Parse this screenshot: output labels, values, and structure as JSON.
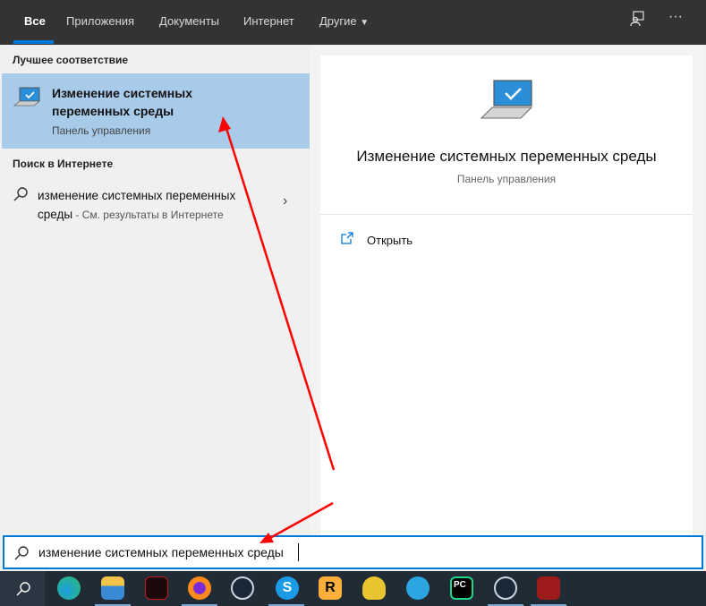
{
  "tabs": [
    {
      "label": "Все"
    },
    {
      "label": "Приложения"
    },
    {
      "label": "Документы"
    },
    {
      "label": "Интернет"
    },
    {
      "label": "Другие"
    }
  ],
  "left": {
    "best_match_heading": "Лучшее соответствие",
    "best_match": {
      "title": "Изменение системных переменных среды",
      "subtitle": "Панель управления"
    },
    "web_heading": "Поиск в Интернете",
    "web_result": {
      "query": "изменение системных переменных среды",
      "suffix": " - См. результаты в Интернете"
    }
  },
  "right": {
    "title": "Изменение системных переменных среды",
    "subtitle": "Панель управления",
    "open_label": "Открыть"
  },
  "search": {
    "value": "изменение системных переменных среды"
  },
  "taskbar": [
    "edge",
    "explorer",
    "msi-dragon",
    "firefox",
    "steam",
    "skype",
    "rockstar",
    "trophy-app",
    "telegram",
    "pycharm",
    "steam",
    "dota2"
  ],
  "colors": {
    "accent": "#0078d7",
    "selected": "#a9cbea",
    "arrow": "#ff0000"
  }
}
